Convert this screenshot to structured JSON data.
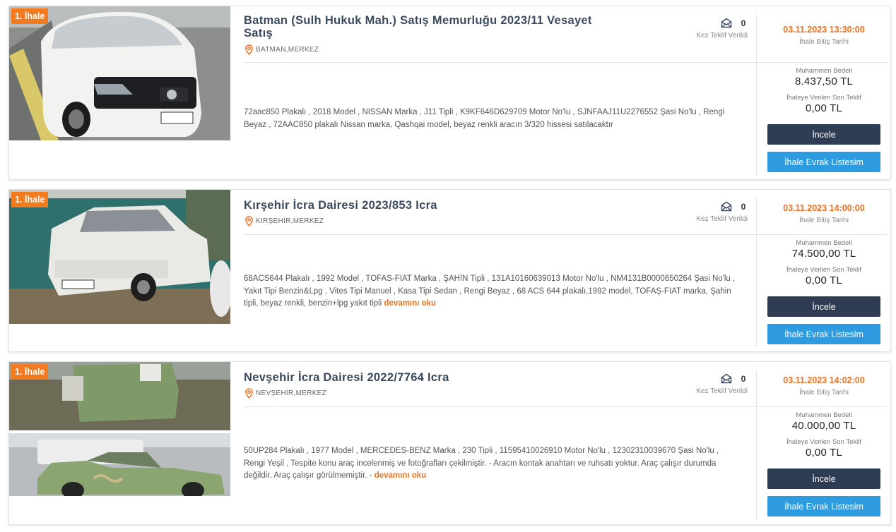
{
  "listings": [
    {
      "badge": "1. İhale",
      "title": "Batman (Sulh Hukuk Mah.) Satış Memurluğu 2023/11 Vesayet Satış",
      "location": "BATMAN,MERKEZ",
      "offer_count": "0",
      "offer_label": "Kez Teklif Verildi",
      "end_date": "03.11.2023 13:30:00",
      "end_date_label": "İhale Bitiş Tarihi",
      "description": "72aac850 Plakalı , 2018 Model , NISSAN Marka , J11 Tipli , K9KF646D629709 Motor No'lu , SJNFAAJ11U2276552 Şasi No'lu , Rengi Beyaz , 72AAC850 plakalı Nissan marka, Qashqai model, beyaz renkli aracın 3/320 hissesi satılacaktır",
      "read_more": "",
      "estimate_label": "Muhammen Bedeli",
      "estimate_value": "8.437,50 TL",
      "last_offer_label": "İhaleye Verilen Son Teklif",
      "last_offer_value": "0,00 TL",
      "inspect_label": "İncele",
      "docs_label": "İhale Evrak Listesim"
    },
    {
      "badge": "1. İhale",
      "title": "Kırşehir İcra Dairesi 2023/853 Icra",
      "location": "KIRŞEHİR,MERKEZ",
      "offer_count": "0",
      "offer_label": "Kez Teklif Verildi",
      "end_date": "03.11.2023 14:00:00",
      "end_date_label": "İhale Bitiş Tarihi",
      "description": "68ACS644 Plakalı , 1992 Model , TOFAS-FIAT Marka , ŞAHİN Tipli , 131A10160639013 Motor No'lu , NM4131B0000650264 Şasi No'lu , Yakıt Tipi Benzin&Lpg , Vites Tipi Manuel , Kasa Tipi Sedan , Rengi Beyaz , 68 ACS 644 plakalı,1992 model, TOFAŞ-FIAT marka, Şahin tipli, beyaz renkli, benzin+lpg yakıt tipli",
      "read_more": "devamını oku",
      "estimate_label": "Muhammen Bedeli",
      "estimate_value": "74.500,00 TL",
      "last_offer_label": "İhaleye Verilen Son Teklif",
      "last_offer_value": "0,00 TL",
      "inspect_label": "İncele",
      "docs_label": "İhale Evrak Listesim"
    },
    {
      "badge": "1. İhale",
      "title": "Nevşehir İcra Dairesi 2022/7764 Icra",
      "location": "NEVŞEHİR,MERKEZ",
      "offer_count": "0",
      "offer_label": "Kez Teklif Verildi",
      "end_date": "03.11.2023 14:02:00",
      "end_date_label": "İhale Bitiş Tarihi",
      "description": "50UP284 Plakalı , 1977 Model , MERCEDES-BENZ Marka , 230 Tipli , 11595410026910 Motor No'lu , 12302310039670 Şasi No'lu , Rengi Yeşil , Tespite konu araç incelenmiş ve fotoğrafları çekilmiştir. - Aracın kontak anahtarı ve ruhsatı yoktur. Araç çalışır durumda değildir. Araç çalışır görülmemiştir. -",
      "read_more": "devamını oku",
      "estimate_label": "Muhammen Bedeli",
      "estimate_value": "40.000,00 TL",
      "last_offer_label": "İhaleye Verilen Son Teklif",
      "last_offer_value": "0,00 TL",
      "inspect_label": "İncele",
      "docs_label": "İhale Evrak Listesim"
    }
  ],
  "colors": {
    "accent_orange": "#f07022",
    "badge_orange": "#f47a20",
    "button_dark": "#2e3c54",
    "button_blue": "#2e9ae0"
  },
  "icons": {
    "location": "map-pin-icon",
    "offers": "envelope-open-icon"
  },
  "photos": [
    "white-nissan-qashqai-photo",
    "white-tofas-sahin-photo",
    "green-mercedes-230-photo"
  ]
}
